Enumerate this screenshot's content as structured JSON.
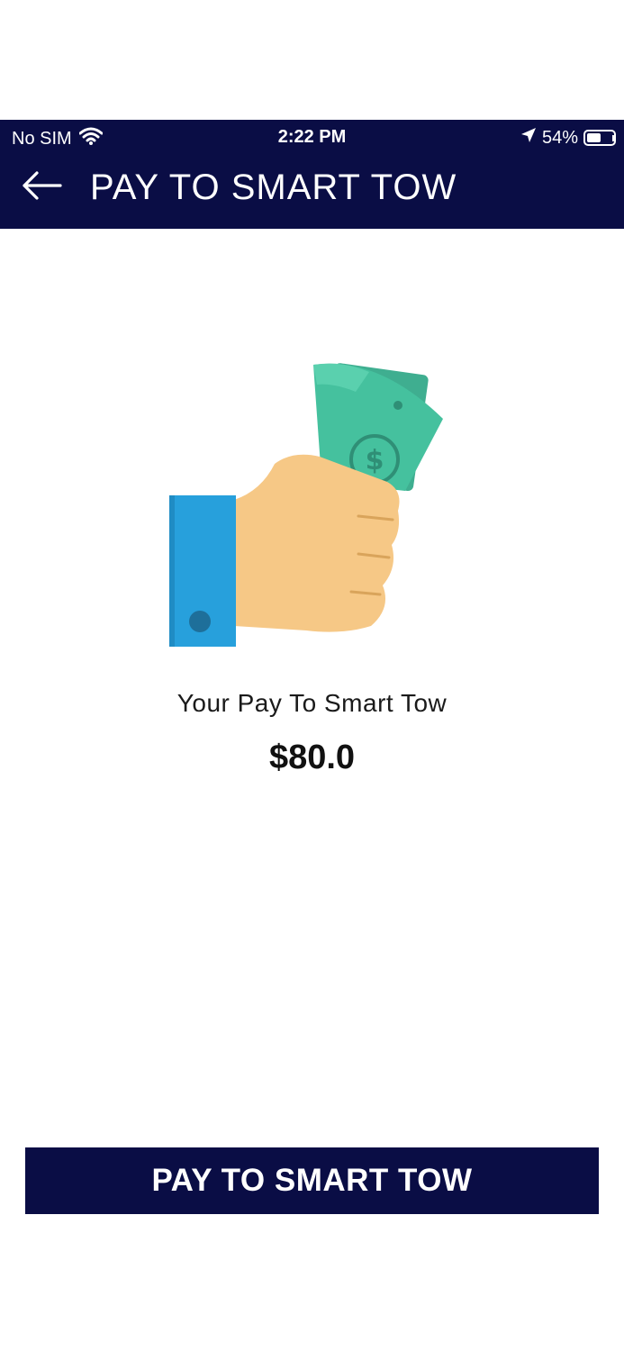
{
  "status_bar": {
    "carrier": "No SIM",
    "time": "2:22 PM",
    "battery": "54%",
    "battery_level": 0.54,
    "icons": [
      "wifi-icon",
      "location-arrow-icon",
      "battery-icon"
    ]
  },
  "header": {
    "title": "PAY TO SMART TOW",
    "back_icon": "arrow-left-icon"
  },
  "main": {
    "illustration": "hand-holding-money-icon",
    "label": "Your Pay To Smart Tow",
    "amount": "$80.0"
  },
  "footer": {
    "button_label": "PAY TO SMART TOW"
  },
  "colors": {
    "header_bg": "#0a0d45",
    "button_bg": "#0a0d45",
    "money_green": "#45c19e",
    "sleeve_blue": "#27a0dc",
    "skin": "#f6c886"
  }
}
